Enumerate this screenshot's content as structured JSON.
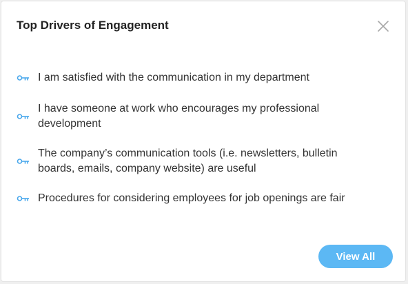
{
  "card": {
    "title": "Top Drivers of Engagement",
    "close_icon": "close-icon",
    "drivers": [
      {
        "icon": "key-icon",
        "text": "I am satisfied with the communication in my department"
      },
      {
        "icon": "key-icon",
        "text": "I have someone at work who encourages my professional development"
      },
      {
        "icon": "key-icon",
        "text": "The company’s communication tools (i.e. newsletters, bulletin boards, emails, company website) are useful"
      },
      {
        "icon": "key-icon",
        "text": "Procedures for considering employees for job openings are fair"
      }
    ],
    "view_all_label": "View All"
  },
  "colors": {
    "accent": "#5cb8f4",
    "icon": "#4aa8ec",
    "title_text": "#222222",
    "body_text": "#333333"
  }
}
